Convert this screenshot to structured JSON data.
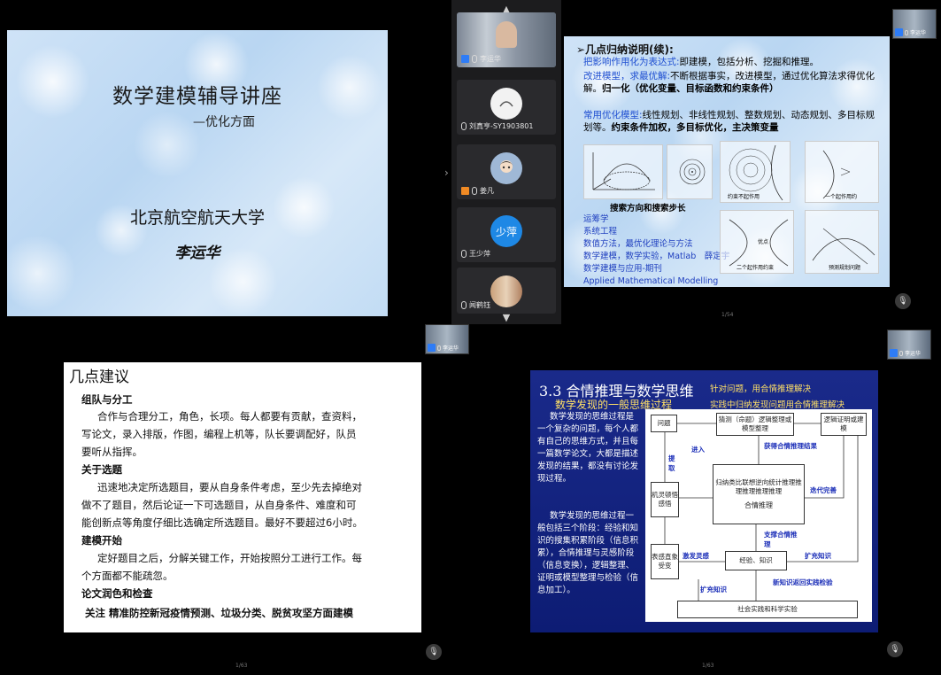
{
  "slide1": {
    "title": "数学建模辅导讲座",
    "subtitle": "—优化方面",
    "org": "北京航空航天大学",
    "author": "李运华"
  },
  "strip": {
    "participants": [
      {
        "name": "李运华",
        "avatar": "video"
      },
      {
        "name": "刘真亨-SY1903801",
        "avatar": "generic"
      },
      {
        "name": "姜凡",
        "avatar": "anime"
      },
      {
        "name": "王少萍",
        "avatar_text": "少萍"
      },
      {
        "name": "闻鹤钰",
        "avatar": "photo"
      }
    ]
  },
  "slide2": {
    "heading": "➢几点归纳说明(续):",
    "l1a": "把影响作用化为表达式:",
    "l1b": "即建模，包括分析、挖掘和推理。",
    "l2a": "改进模型，求最优解:",
    "l2b": "不断根据事实，改进模型，通过优化算法求得优化解。",
    "l2c": "归一化（优化变量、目标函数和约束条件）",
    "l3a": "常用优化模型:",
    "l3b": "线性规划、非线性规划、整数规划、动态规划、多目标规划等。",
    "l3c": "约束条件加权，多目标优化，主决策变量",
    "diagram_caption": "搜索方向和搜索步长",
    "menu": [
      "运筹学",
      "系统工程",
      "数值方法，最优化理论与方法",
      "数学建模，数学实验，Matlab　薛定宇",
      "数学建模与应用-期刊",
      "Applied Mathematical Modelling"
    ],
    "d1": "约束不起作用",
    "d2": "一个起作用约",
    "d3": "二个起作用约束",
    "d4": "预测规划问题",
    "d5": "优点",
    "page": "1/54"
  },
  "slide3": {
    "heading": "几点建议",
    "s1": "组队与分工",
    "p1a": "合作与合理分工，角色，长项。每人都要有贡献，查资料，",
    "p1b": "写论文，录入排版，作图，编程上机等，队长要调配好，队员",
    "p1c": "要听从指挥。",
    "s2": "关于选题",
    "p2a": "迅速地决定所选题目，要从自身条件考虑，至少先去掉绝对",
    "p2b": "做不了题目，然后论证一下可选题目，从自身条件、难度和可",
    "p2c": "能创新点等角度仔细比选确定所选题目。最好不要超过6小时。",
    "s3": "建模开始",
    "p3a": "定好题目之后，分解关键工作，开始按照分工进行工作。每",
    "p3b": "个方面都不能疏忽。",
    "s4": "论文润色和检查",
    "p4": "关注 精准防控新冠疫情预测、垃圾分类、脱贫攻坚方面建模",
    "page": "1/63"
  },
  "slide4": {
    "heading": "3.3 合情推理与数学思维",
    "heading_note": "针对问题，用合情推理解决",
    "sub1": "数学发现的一般思维过程",
    "sub2": "实践中归纳发现问题用合情推理解决",
    "t1": "数学发现的思维过程是一个复杂的问题，每个人都有自己的思维方式，并且每一篇数学论文，大都是描述发现的结果，都没有讨论发现过程。",
    "t2": "数学发现的思维过程一般包括三个阶段：经验和知识的搜集积累阶段（信息积累），合情推理与灵感阶段（信息变换），逻辑整理、证明或模型整理与检验（信息加工）。",
    "b_problem": "问题",
    "b_guess": "猜测（命题）逻辑整理或模型整理",
    "b_logic": "逻辑证明或建模",
    "b_intuition": "机灵顿悟感悟",
    "b_reason": "归纳类比联想逆向统计推理推理推理推理推理",
    "b_reason_title": "合情推理",
    "b_sense": "表感直象受变",
    "b_exp": "经验、知识",
    "b_society": "社会实践和科学实验",
    "a_enter": "进入",
    "a_extract": "提取",
    "a_get": "获得合情推理结果",
    "a_iter": "迭代完善",
    "a_inspire": "激发灵感",
    "a_support": "支撑合情推理",
    "a_expand": "扩充知识",
    "a_expand2": "扩充知识",
    "a_newk": "新知识返回实践检验",
    "page": "1/63"
  }
}
